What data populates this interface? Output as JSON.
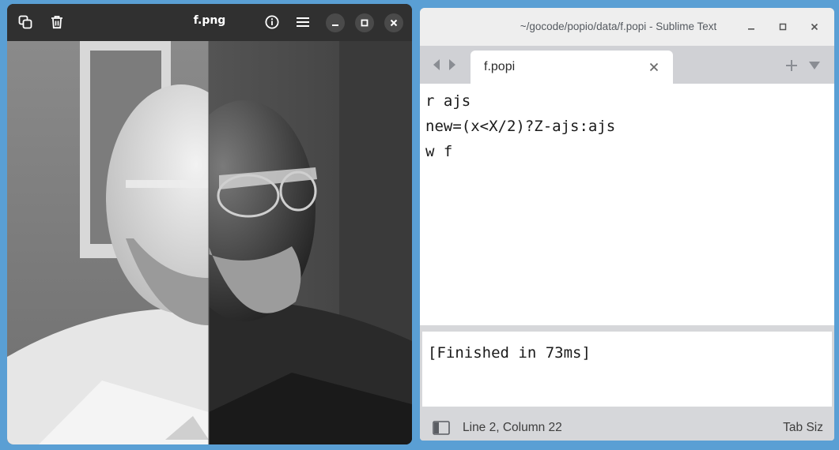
{
  "image_viewer": {
    "title": "f.png",
    "icons": {
      "copy": "copy-icon",
      "delete": "trash-icon",
      "info": "info-icon",
      "menu": "hamburger-menu-icon",
      "minimize": "minimize-icon",
      "maximize": "maximize-icon",
      "close": "close-icon"
    },
    "colors": {
      "header": "#303030",
      "title": "#ffffff"
    }
  },
  "sublime": {
    "title": "~/gocode/popio/data/f.popi - Sublime Text",
    "tab": {
      "label": "f.popi"
    },
    "editor_lines": [
      "r ajs",
      "new=(x<X/2)?Z-ajs:ajs",
      "w f"
    ],
    "output": "[Finished in 73ms]",
    "status": {
      "position": "Line 2, Column 22",
      "tab_size": "Tab Siz"
    },
    "colors": {
      "titlebar": "#eeeeee",
      "chrome": "#d6d7da",
      "editor": "#ffffff"
    }
  },
  "desktop": {
    "background": "#5a9fd4"
  }
}
